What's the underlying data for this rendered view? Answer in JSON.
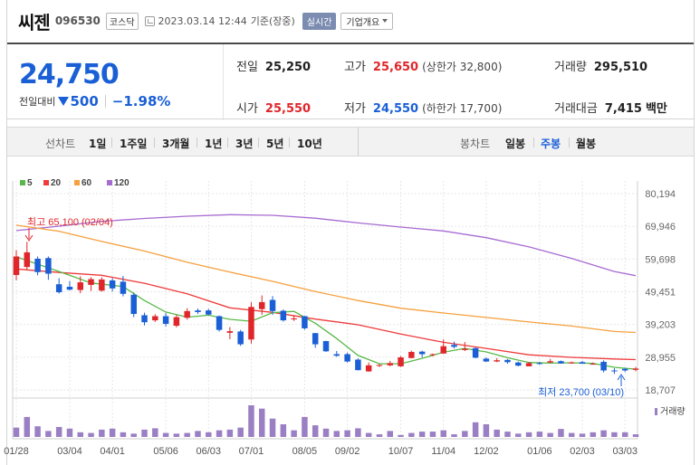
{
  "header": {
    "name": "씨젠",
    "code": "096530",
    "market": "코스닥",
    "datetime": "2023.03.14 12:44",
    "basis": "기준(장중)",
    "realtime": "실시간",
    "company_info": "기업개요"
  },
  "quote": {
    "price": "24,750",
    "change_label": "전일대비",
    "change": "500",
    "change_rate": "−1.98%",
    "prev_close_label": "전일",
    "prev_close": "25,250",
    "open_label": "시가",
    "open": "25,550",
    "high_label": "고가",
    "high": "25,650",
    "upper_limit": "(상한가 32,800)",
    "low_label": "저가",
    "low": "24,550",
    "lower_limit": "(하한가 17,700)",
    "volume_label": "거래량",
    "volume": "295,510",
    "amount_label": "거래대금",
    "amount": "7,415",
    "amount_unit": "백만"
  },
  "toolbar": {
    "line_label": "선차트",
    "periods": [
      "1일",
      "1주일",
      "3개월",
      "1년",
      "3년",
      "5년",
      "10년"
    ],
    "candle_label": "봉차트",
    "candle_types": [
      "일봉",
      "주봉",
      "월봉"
    ],
    "selected_candle": "주봉"
  },
  "colors": {
    "up": "#e0262a",
    "down": "#1a5fd6",
    "ma5": "#58b948",
    "ma20": "#ef3b3b",
    "ma60": "#f5a03c",
    "ma120": "#a76bd2",
    "volume": "#9b7fc4"
  },
  "chart_data": {
    "type": "candlestick",
    "legend": [
      "5",
      "20",
      "60",
      "120"
    ],
    "y_ticks": [
      "80,194",
      "69,946",
      "59,698",
      "49,451",
      "39,203",
      "28,955",
      "18,707"
    ],
    "ylim": [
      18707,
      80194
    ],
    "x_ticks": [
      "01/28",
      "03/04",
      "04/01",
      "05/06",
      "06/03",
      "07/01",
      "08/05",
      "09/02",
      "10/07",
      "11/04",
      "12/02",
      "01/06",
      "02/03",
      "03/03"
    ],
    "x_tick_index": [
      0,
      5,
      9,
      14,
      18,
      22,
      27,
      31,
      36,
      40,
      44,
      49,
      53,
      57
    ],
    "annotation_high": "최고 65,100 (02/04)",
    "annotation_low": "최저 23,700 (03/10)",
    "volume_label": "거래량",
    "candles": [
      {
        "o": 54700,
        "c": 60500,
        "h": 62500,
        "l": 53000
      },
      {
        "o": 57200,
        "c": 61800,
        "h": 65100,
        "l": 56300
      },
      {
        "o": 59800,
        "c": 55600,
        "h": 60500,
        "l": 54600
      },
      {
        "o": 60000,
        "c": 55100,
        "h": 60500,
        "l": 53200
      },
      {
        "o": 51800,
        "c": 49300,
        "h": 53700,
        "l": 48900
      },
      {
        "o": 51000,
        "c": 50100,
        "h": 52800,
        "l": 49900
      },
      {
        "o": 50000,
        "c": 52400,
        "h": 54300,
        "l": 49000
      },
      {
        "o": 51600,
        "c": 53400,
        "h": 54000,
        "l": 49700
      },
      {
        "o": 49800,
        "c": 53300,
        "h": 54000,
        "l": 49500
      },
      {
        "o": 53000,
        "c": 50500,
        "h": 53700,
        "l": 49500
      },
      {
        "o": 52600,
        "c": 48800,
        "h": 54400,
        "l": 48000
      },
      {
        "o": 48500,
        "c": 42500,
        "h": 49200,
        "l": 41500
      },
      {
        "o": 42100,
        "c": 39900,
        "h": 42900,
        "l": 38900
      },
      {
        "o": 40500,
        "c": 41800,
        "h": 42400,
        "l": 40000
      },
      {
        "o": 41800,
        "c": 39400,
        "h": 42800,
        "l": 38600
      },
      {
        "o": 38800,
        "c": 41500,
        "h": 42200,
        "l": 38300
      },
      {
        "o": 41300,
        "c": 43400,
        "h": 44300,
        "l": 40700
      },
      {
        "o": 43600,
        "c": 43100,
        "h": 44200,
        "l": 42500
      },
      {
        "o": 43600,
        "c": 42300,
        "h": 44100,
        "l": 42100
      },
      {
        "o": 41800,
        "c": 37500,
        "h": 42000,
        "l": 37000
      },
      {
        "o": 36600,
        "c": 37100,
        "h": 38400,
        "l": 34600
      },
      {
        "o": 37000,
        "c": 33000,
        "h": 37500,
        "l": 32500
      },
      {
        "o": 34500,
        "c": 44700,
        "h": 46200,
        "l": 33200
      },
      {
        "o": 44000,
        "c": 46200,
        "h": 48300,
        "l": 42200
      },
      {
        "o": 46900,
        "c": 43400,
        "h": 48100,
        "l": 42200
      },
      {
        "o": 43500,
        "c": 40500,
        "h": 43900,
        "l": 40100
      },
      {
        "o": 40800,
        "c": 41100,
        "h": 42100,
        "l": 40300
      },
      {
        "o": 41800,
        "c": 38000,
        "h": 41900,
        "l": 37600
      },
      {
        "o": 36500,
        "c": 33000,
        "h": 36500,
        "l": 31900
      },
      {
        "o": 34000,
        "c": 30800,
        "h": 34100,
        "l": 30600
      },
      {
        "o": 29900,
        "c": 29400,
        "h": 30900,
        "l": 29100
      },
      {
        "o": 29900,
        "c": 27600,
        "h": 30400,
        "l": 27300
      },
      {
        "o": 28200,
        "c": 24900,
        "h": 28600,
        "l": 24800
      },
      {
        "o": 24500,
        "c": 26400,
        "h": 27300,
        "l": 24400
      },
      {
        "o": 26300,
        "c": 26500,
        "h": 26800,
        "l": 25900
      },
      {
        "o": 26400,
        "c": 27100,
        "h": 27800,
        "l": 26100
      },
      {
        "o": 26100,
        "c": 28900,
        "h": 29300,
        "l": 25900
      },
      {
        "o": 28700,
        "c": 30600,
        "h": 31000,
        "l": 28600
      },
      {
        "o": 30700,
        "c": 29900,
        "h": 31000,
        "l": 28900
      },
      {
        "o": 29700,
        "c": 29900,
        "h": 30100,
        "l": 29200
      },
      {
        "o": 30100,
        "c": 32400,
        "h": 34500,
        "l": 30000
      },
      {
        "o": 32800,
        "c": 32200,
        "h": 33800,
        "l": 31700
      },
      {
        "o": 31200,
        "c": 31600,
        "h": 33700,
        "l": 30900
      },
      {
        "o": 31800,
        "c": 28800,
        "h": 32000,
        "l": 28600
      },
      {
        "o": 28500,
        "c": 27600,
        "h": 28900,
        "l": 27500
      },
      {
        "o": 27600,
        "c": 28000,
        "h": 28700,
        "l": 27400
      },
      {
        "o": 28100,
        "c": 27400,
        "h": 28400,
        "l": 26900
      },
      {
        "o": 27300,
        "c": 26300,
        "h": 27600,
        "l": 26100
      },
      {
        "o": 26100,
        "c": 27100,
        "h": 27400,
        "l": 26100
      },
      {
        "o": 27100,
        "c": 27000,
        "h": 27500,
        "l": 26600
      },
      {
        "o": 27300,
        "c": 27700,
        "h": 28400,
        "l": 27100
      },
      {
        "o": 27700,
        "c": 27000,
        "h": 27900,
        "l": 26900
      },
      {
        "o": 27300,
        "c": 27300,
        "h": 27600,
        "l": 26900
      },
      {
        "o": 27400,
        "c": 26900,
        "h": 27800,
        "l": 26900
      },
      {
        "o": 26900,
        "c": 26900,
        "h": 27300,
        "l": 26700
      },
      {
        "o": 27500,
        "c": 24800,
        "h": 28000,
        "l": 24200
      },
      {
        "o": 24800,
        "c": 24600,
        "h": 25500,
        "l": 23700
      },
      {
        "o": 25300,
        "c": 24800,
        "h": 25600,
        "l": 24300
      },
      {
        "o": 25000,
        "c": 25400,
        "h": 25900,
        "l": 24500
      }
    ],
    "ma": {
      "5": [
        [
          0,
          60400
        ],
        [
          4,
          55800
        ],
        [
          7,
          52200
        ],
        [
          10,
          51100
        ],
        [
          12,
          46700
        ],
        [
          14,
          43100
        ],
        [
          16,
          41500
        ],
        [
          18,
          42100
        ],
        [
          20,
          40800
        ],
        [
          22,
          40200
        ],
        [
          24,
          42900
        ],
        [
          26,
          43300
        ],
        [
          28,
          39600
        ],
        [
          30,
          34800
        ],
        [
          32,
          29500
        ],
        [
          34,
          26900
        ],
        [
          36,
          26900
        ],
        [
          38,
          28600
        ],
        [
          40,
          30500
        ],
        [
          42,
          31700
        ],
        [
          44,
          30600
        ],
        [
          46,
          28800
        ],
        [
          48,
          27300
        ],
        [
          50,
          27100
        ],
        [
          52,
          27200
        ],
        [
          54,
          27000
        ],
        [
          56,
          25800
        ],
        [
          58,
          25200
        ]
      ],
      "20": [
        [
          0,
          56600
        ],
        [
          4,
          55500
        ],
        [
          8,
          54600
        ],
        [
          12,
          52100
        ],
        [
          16,
          48800
        ],
        [
          20,
          44400
        ],
        [
          24,
          43000
        ],
        [
          28,
          40900
        ],
        [
          32,
          39100
        ],
        [
          36,
          36200
        ],
        [
          40,
          33600
        ],
        [
          44,
          31700
        ],
        [
          48,
          29700
        ],
        [
          52,
          28900
        ],
        [
          56,
          28400
        ],
        [
          58,
          28200
        ]
      ],
      "60": [
        [
          0,
          70300
        ],
        [
          4,
          68400
        ],
        [
          8,
          65200
        ],
        [
          12,
          62200
        ],
        [
          16,
          58700
        ],
        [
          20,
          55600
        ],
        [
          24,
          52700
        ],
        [
          28,
          49500
        ],
        [
          32,
          46700
        ],
        [
          36,
          44300
        ],
        [
          40,
          42800
        ],
        [
          44,
          41400
        ],
        [
          48,
          40000
        ],
        [
          52,
          38700
        ],
        [
          56,
          37000
        ],
        [
          58,
          36700
        ]
      ],
      "120": [
        [
          0,
          68600
        ],
        [
          4,
          70000
        ],
        [
          8,
          71500
        ],
        [
          12,
          72400
        ],
        [
          16,
          73100
        ],
        [
          20,
          73600
        ],
        [
          24,
          73400
        ],
        [
          28,
          72500
        ],
        [
          32,
          71000
        ],
        [
          36,
          69700
        ],
        [
          40,
          68500
        ],
        [
          44,
          66400
        ],
        [
          48,
          63500
        ],
        [
          52,
          59900
        ],
        [
          56,
          55800
        ],
        [
          58,
          54500
        ]
      ]
    },
    "volume": [
      28,
      60,
      32,
      18,
      30,
      25,
      14,
      12,
      22,
      25,
      14,
      10,
      22,
      26,
      12,
      10,
      12,
      18,
      14,
      20,
      22,
      28,
      95,
      85,
      55,
      38,
      20,
      60,
      35,
      25,
      18,
      20,
      26,
      12,
      8,
      18,
      6,
      12,
      16,
      16,
      20,
      8,
      18,
      44,
      38,
      22,
      16,
      10,
      14,
      16,
      12,
      24,
      12,
      10,
      14,
      20,
      14,
      14,
      8
    ]
  }
}
